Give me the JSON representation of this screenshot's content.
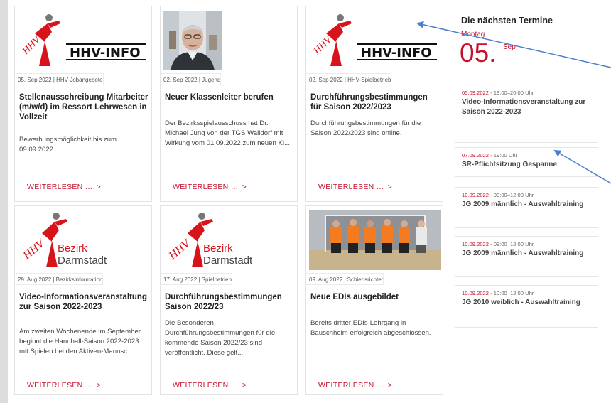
{
  "cards": [
    {
      "meta": "05. Sep 2022 | HHV-Jobangebote",
      "title": "Stellenausschreibung Mitarbeiter (m/w/d) im Ressort Lehrwesen in Vollzeit",
      "excerpt": "Bewerbungsmöglichkeit bis zum 09.09.2022",
      "more": "WEITERLESEN …",
      "logo_text": "HHV-INFO",
      "logo_small": "HHV"
    },
    {
      "meta": "02. Sep 2022 | Jugend",
      "title": "Neuer Klassenleiter berufen",
      "excerpt": "Der Bezirksspielausschuss hat Dr. Michael Jung von der TGS Walldorf mit Wirkung vom 01.09.2022 zum neuen Kl...",
      "more": "WEITERLESEN …"
    },
    {
      "meta": "02. Sep 2022 | HHV-Spielbetrieb",
      "title": "Durchführungsbestimmungen für Saison 2022/2023",
      "excerpt": "Durchführungsbestimmungen für die Saison 2022/2023 sind online.",
      "more": "WEITERLESEN …",
      "logo_text": "HHV-INFO",
      "logo_small": "HHV"
    },
    {
      "meta": "29. Aug 2022 | Bezirksinformation",
      "title": "Video-Informationsveranstaltung zur Saison 2022-2023",
      "excerpt": "Am zweiten Wochenende im September beginnt die Handball-Saison 2022-2023 mit Spielen bei den Aktiven-Mannsc...",
      "more": "WEITERLESEN …",
      "logo_small": "HHV",
      "logo_line1": "Bezirk",
      "logo_line2": "Darmstadt"
    },
    {
      "meta": "17. Aug 2022 | Spielbetrieb",
      "title": "Durchführungsbestimmungen Saison 2022/23",
      "excerpt": "Die Besonderen Durchführungsbestimmungen für die kommende Saison 2022/23 sind veröffentlicht. Diese gelt...",
      "more": "WEITERLESEN …",
      "logo_small": "HHV",
      "logo_line1": "Bezirk",
      "logo_line2": "Darmstadt"
    },
    {
      "meta": "09. Aug 2022 | Schiedsrichter",
      "title": "Neue EDIs ausgebildet",
      "excerpt": "Bereits dritter EDIs-Lehrgang in Bauschheim erfolgreich abgeschlossen.",
      "more": "WEITERLESEN …"
    }
  ],
  "sidebar": {
    "title": "Die nächsten Termine",
    "day_name": "Montag",
    "day_number": "05.",
    "month": "Sep",
    "events": [
      {
        "date": "05.09.2022",
        "time": " - 19:00–20:00 Uhr",
        "title": "Video-Informationsveranstaltung zur Saison 2022-2023"
      },
      {
        "date": "07.09.2022",
        "time": " - 19:00 Uhr",
        "title": "SR-Pflichtsitzung Gespanne"
      },
      {
        "date": "10.09.2022",
        "time": " - 09:00–12:00 Uhr",
        "title": "JG 2009 männlich - Auswahltraining"
      },
      {
        "date": "10.09.2022",
        "time": " - 09:00–12:00 Uhr",
        "title": "JG 2009 männlich - Auswahltraining"
      },
      {
        "date": "10.09.2022",
        "time": " - 10:00–12:00 Uhr",
        "title": "JG 2010 weiblich - Auswahltraining"
      }
    ]
  },
  "colors": {
    "accent": "#c8102e",
    "arrow": "#4a7fcf"
  }
}
